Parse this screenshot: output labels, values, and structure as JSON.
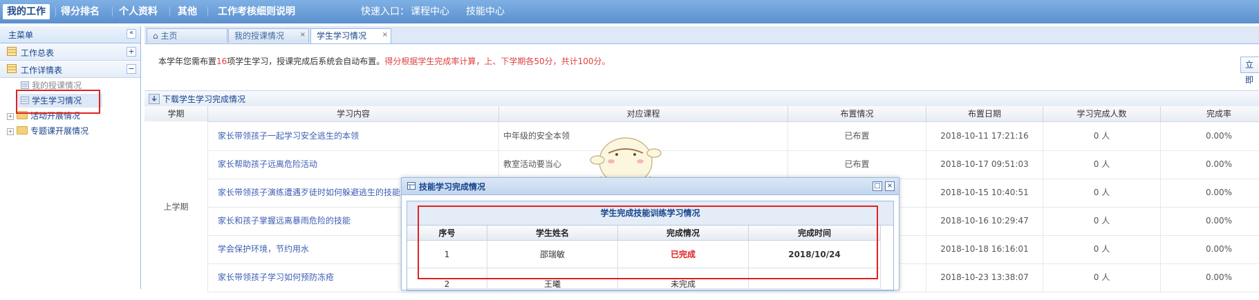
{
  "topnav": {
    "items": [
      "我的工作",
      "得分排名",
      "个人资料",
      "其他",
      "工作考核细则说明"
    ],
    "quick_label": "快速入口：",
    "quick_links": [
      "课程中心",
      "技能中心"
    ]
  },
  "sidebar": {
    "title": "主菜单",
    "collapse_glyph": "«",
    "groups": [
      {
        "label": "工作总表",
        "toggle": "+"
      },
      {
        "label": "工作详情表",
        "toggle": "−"
      }
    ],
    "nodes": [
      "我的授课情况",
      "学生学习情况",
      "活动开展情况",
      "专题课开展情况"
    ]
  },
  "tabs": [
    {
      "label": "主页"
    },
    {
      "label": "我的授课情况",
      "close": "×"
    },
    {
      "label": "学生学习情况",
      "close": "×"
    }
  ],
  "notice": {
    "part1": "本学年您需布置",
    "count": "16",
    "part2": "项学生学习，授课完成后系统会自动布置。",
    "red": "得分根据学生完成率计算，上、下学期各50分，共计100分。",
    "right_btn": "立即"
  },
  "download": {
    "label": "下载学生学习完成情况"
  },
  "grid": {
    "headers": [
      "学期",
      "学习内容",
      "对应课程",
      "布置情况",
      "布置日期",
      "学习完成人数",
      "完成率"
    ],
    "term": "上学期",
    "rows": [
      {
        "content": "家长带领孩子一起学习安全逃生的本领",
        "course": "中年级的安全本领",
        "status": "已布置",
        "date": "2018-10-11 17:21:16",
        "count": "0 人",
        "rate": "0.00%"
      },
      {
        "content": "家长帮助孩子远离危险活动",
        "course": "教室活动要当心",
        "status": "已布置",
        "date": "2018-10-17 09:51:03",
        "count": "0 人",
        "rate": "0.00%"
      },
      {
        "content": "家长带领孩子演练遭遇歹徒时如何躲避逃生的技能",
        "course": "",
        "status": "",
        "date": "2018-10-15 10:40:51",
        "count": "0 人",
        "rate": "0.00%"
      },
      {
        "content": "家长和孩子掌握远离暴雨危险的技能",
        "course": "",
        "status": "",
        "date": "2018-10-16 10:29:47",
        "count": "0 人",
        "rate": "0.00%"
      },
      {
        "content": "学会保护环境，节约用水",
        "course": "",
        "status": "",
        "date": "2018-10-18 16:16:01",
        "count": "0 人",
        "rate": "0.00%"
      },
      {
        "content": "家长带领孩子学习如何预防冻疮",
        "course": "",
        "status": "",
        "date": "2018-10-23 13:38:07",
        "count": "0 人",
        "rate": "0.00%"
      }
    ]
  },
  "dialog": {
    "title": "技能学习完成情况",
    "caption": "学生完成技能训练学习情况",
    "headers": [
      "序号",
      "学生姓名",
      "完成情况",
      "完成时间"
    ],
    "rows": [
      {
        "no": "1",
        "name": "邵瑞敏",
        "status": "已完成",
        "time": "2018/10/24"
      },
      {
        "no": "2",
        "name": "王曦",
        "status": "未完成",
        "time": ""
      }
    ],
    "min_glyph": "□",
    "close_glyph": "×"
  },
  "colors": {
    "accent": "#5b90cf",
    "highlight": "#e02020",
    "link": "#3f5fb5"
  }
}
